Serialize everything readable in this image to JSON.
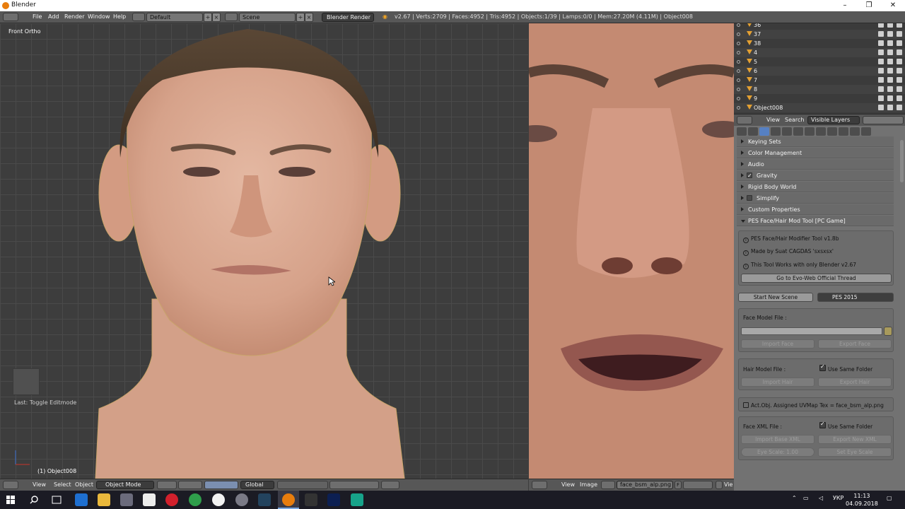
{
  "window": {
    "title": "Blender",
    "minimize": "–",
    "maximize": "❐",
    "close": "✕"
  },
  "infobar": {
    "menus": [
      "File",
      "Add",
      "Render",
      "Window",
      "Help"
    ],
    "screen_layout": "Default",
    "scene": "Scene",
    "render_engine": "Blender Render",
    "stats": "v2.67 | Verts:2709 | Faces:4952 | Tris:4952 | Objects:1/39 | Lamps:0/0 | Mem:27.20M (4.11M) | Object008"
  },
  "viewport": {
    "view_name": "Front Ortho",
    "last_operator": "Last: Toggle Editmode",
    "active_object": "(1) Object008"
  },
  "viewport_header": {
    "menus": [
      "View",
      "Select",
      "Object"
    ],
    "mode": "Object Mode",
    "orientation": "Global"
  },
  "image_editor_header": {
    "menus": [
      "View",
      "Image"
    ],
    "image_name": "face_bsm_alp.png",
    "fake_user": "F",
    "view_menu_cut": "Vie"
  },
  "outliner": {
    "rows": [
      {
        "name": "36"
      },
      {
        "name": "37"
      },
      {
        "name": "38"
      },
      {
        "name": "4"
      },
      {
        "name": "5"
      },
      {
        "name": "6"
      },
      {
        "name": "7"
      },
      {
        "name": "8"
      },
      {
        "name": "9"
      },
      {
        "name": "Object008"
      }
    ],
    "header": {
      "view": "View",
      "search": "Search",
      "filter": "Visible Layers"
    }
  },
  "properties": {
    "panels": [
      {
        "label": "Keying Sets",
        "checkbox": null
      },
      {
        "label": "Color Management",
        "checkbox": null
      },
      {
        "label": "Audio",
        "checkbox": null
      },
      {
        "label": "Gravity",
        "checkbox": true
      },
      {
        "label": "Rigid Body World",
        "checkbox": null
      },
      {
        "label": "Simplify",
        "checkbox": false
      },
      {
        "label": "Custom Properties",
        "checkbox": null
      }
    ],
    "addon_panel": "PES Face/Hair Mod Tool [PC Game]",
    "info1": "PES Face/Hair Modifier Tool v1.8b",
    "info2": "Made by Suat CAGDAS 'sxsxsx'",
    "info3": "This Tool Works with only Blender v2.67",
    "thread_button": "Go to Evo-Web Official Thread",
    "start_button": "Start New Scene",
    "game_select": "PES 2015",
    "face_model_label": "Face Model File :",
    "import_face": "Import Face",
    "export_face": "Export Face",
    "hair_model_label": "Hair Model File :",
    "use_same_folder_1": "Use Same Folder",
    "import_hair": "Import Hair",
    "export_hair": "Export Hair",
    "uvmap_info": "Act.Obj. Assigned UVMap Tex = face_bsm_alp.png",
    "face_xml_label": "Face XML File :",
    "use_same_folder_2": "Use Same Folder",
    "import_base_xml": "Import Base XML",
    "export_new_xml": "Export New XML",
    "eye_scale": "Eye Scale: 1.00",
    "set_eye_scale": "Set Eye Scale"
  },
  "taskbar": {
    "lang": "УКР",
    "time": "11:13",
    "date": "04.09.2018"
  }
}
